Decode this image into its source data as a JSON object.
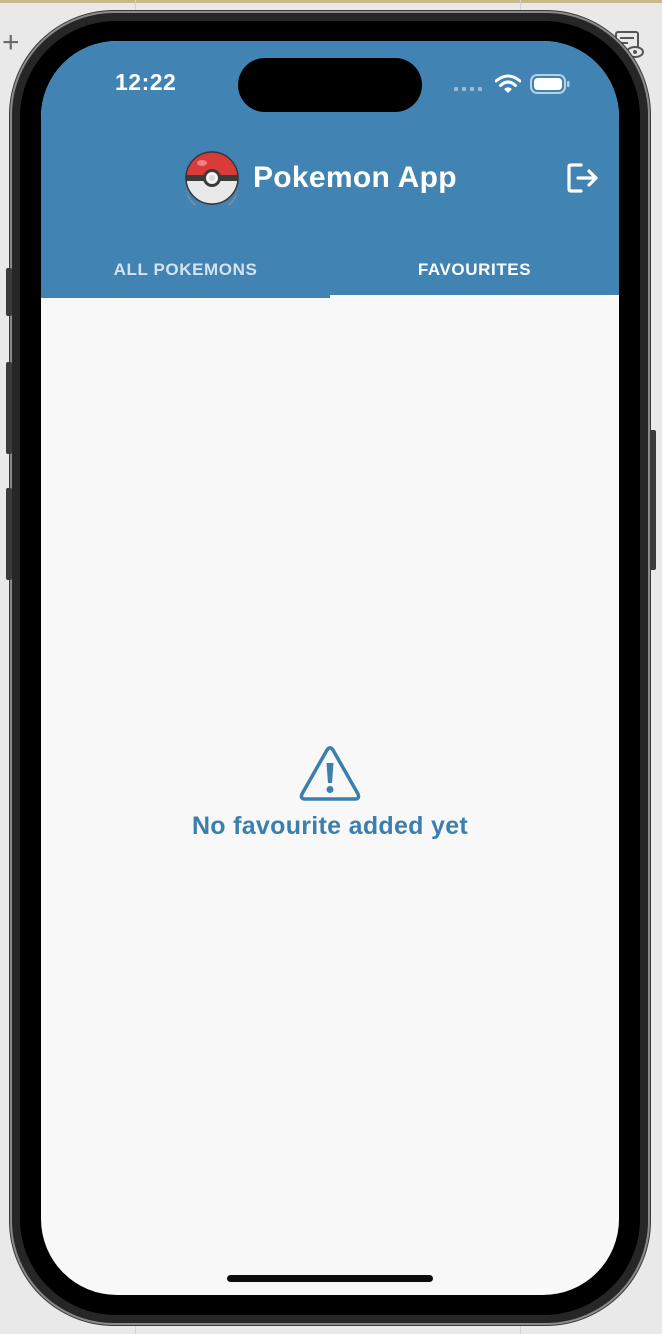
{
  "status_bar": {
    "time": "12:22"
  },
  "app_bar": {
    "title": "Pokemon App",
    "logo_icon": "pokeball-icon",
    "logout_icon": "logout-icon",
    "color": "#4183b2"
  },
  "tabs": [
    {
      "label": "ALL POKEMONS",
      "selected": false
    },
    {
      "label": "FAVOURITES",
      "selected": true
    }
  ],
  "empty_state": {
    "icon": "warning-icon",
    "message": "No favourite added yet",
    "color": "#3b7fae"
  },
  "background": {
    "plus_icon": "plus-icon",
    "inspector_icon": "inspector-icon"
  }
}
